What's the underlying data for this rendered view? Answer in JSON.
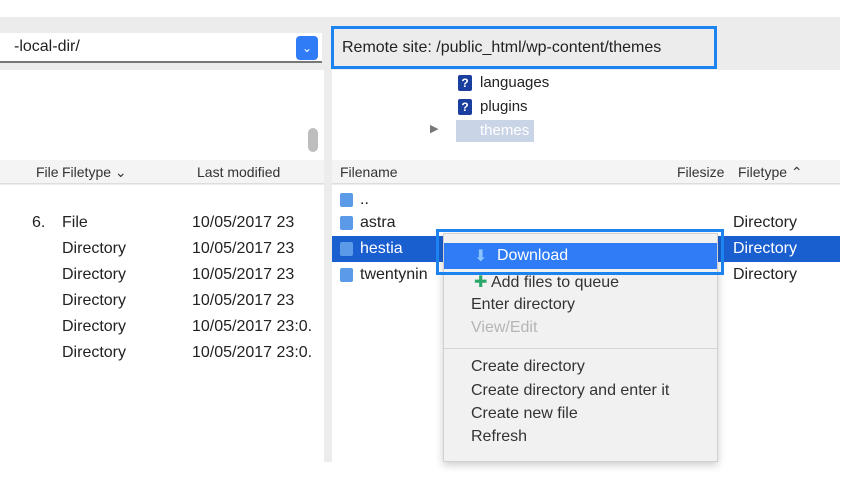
{
  "local": {
    "path": "-local-dir/",
    "columns": [
      "File",
      "Filetype",
      "Last modified"
    ],
    "rows": [
      {
        "size": "6.",
        "type": "File",
        "modified": "10/05/2017 23"
      },
      {
        "size": "",
        "type": "Directory",
        "modified": "10/05/2017 23"
      },
      {
        "size": "",
        "type": "Directory",
        "modified": "10/05/2017 23"
      },
      {
        "size": "",
        "type": "Directory",
        "modified": "10/05/2017 23"
      },
      {
        "size": "",
        "type": "Directory",
        "modified": "10/05/2017 23:0."
      },
      {
        "size": "",
        "type": "Directory",
        "modified": "10/05/2017 23:0."
      }
    ]
  },
  "remote": {
    "label": "Remote site:",
    "path": "/public_html/wp-content/themes",
    "tree": [
      "languages",
      "plugins",
      "themes"
    ],
    "columns": [
      "Filename",
      "Filesize",
      "Filetype"
    ],
    "rows": [
      {
        "name": "..",
        "type": ""
      },
      {
        "name": "astra",
        "type": "Directory"
      },
      {
        "name": "hestia",
        "type": "Directory"
      },
      {
        "name": "twentynin",
        "type": "Directory"
      }
    ]
  },
  "menu": {
    "items": [
      "Download",
      "Add files to queue",
      "Enter directory",
      "View/Edit",
      "Create directory",
      "Create directory and enter it",
      "Create new file",
      "Refresh"
    ]
  },
  "colors": {
    "accent": "#1b84f0",
    "selection": "#1a5fd0"
  }
}
